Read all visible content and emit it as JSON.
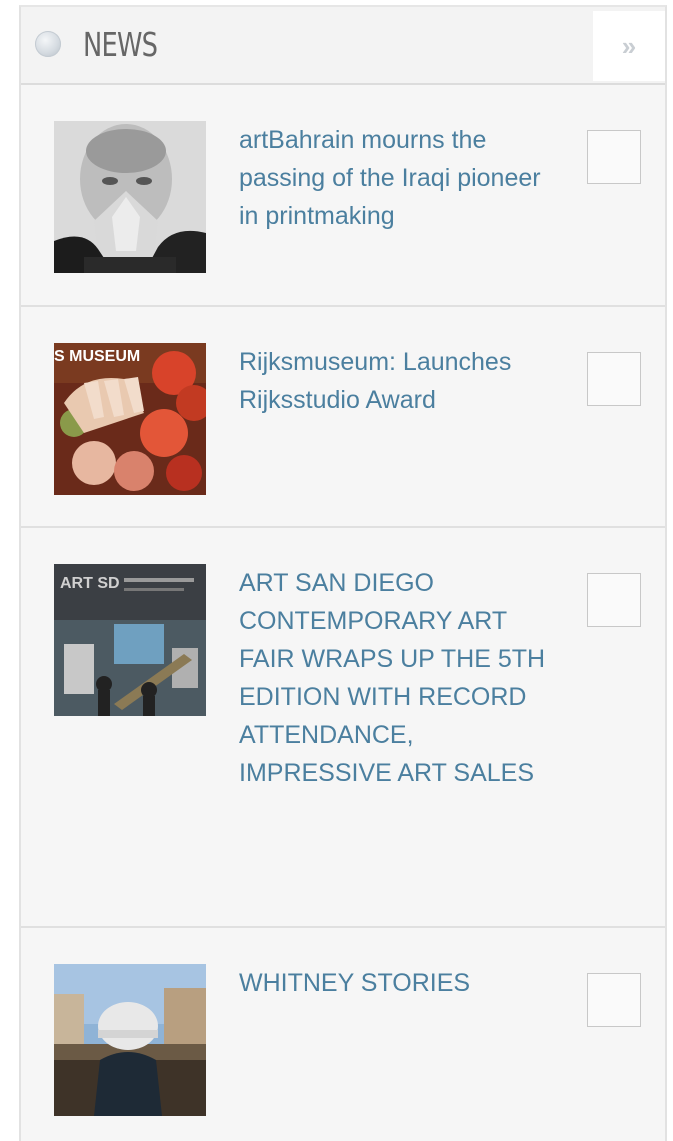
{
  "widget": {
    "title": "NEWS",
    "more_icon": "double-chevron-right-icon",
    "accent_color": "#4b7f9f"
  },
  "items": [
    {
      "headline": "artBahrain mourns the passing of the Iraqi pioneer in printmaking",
      "thumb": "portrait-photo"
    },
    {
      "headline": "Rijksmuseum: Launches Rijksstudio Award",
      "thumb": "flowers-photo",
      "thumb_text": "S MUSEUM"
    },
    {
      "headline": "ART SAN DIEGO CONTEMPORARY ART FAIR WRAPS UP THE 5TH EDITION WITH RECORD ATTENDANCE, IMPRESSIVE ART SALES",
      "thumb": "art-fair-photo",
      "thumb_text": "ART SD"
    },
    {
      "headline": "WHITNEY STORIES",
      "thumb": "hardhat-photo"
    }
  ]
}
